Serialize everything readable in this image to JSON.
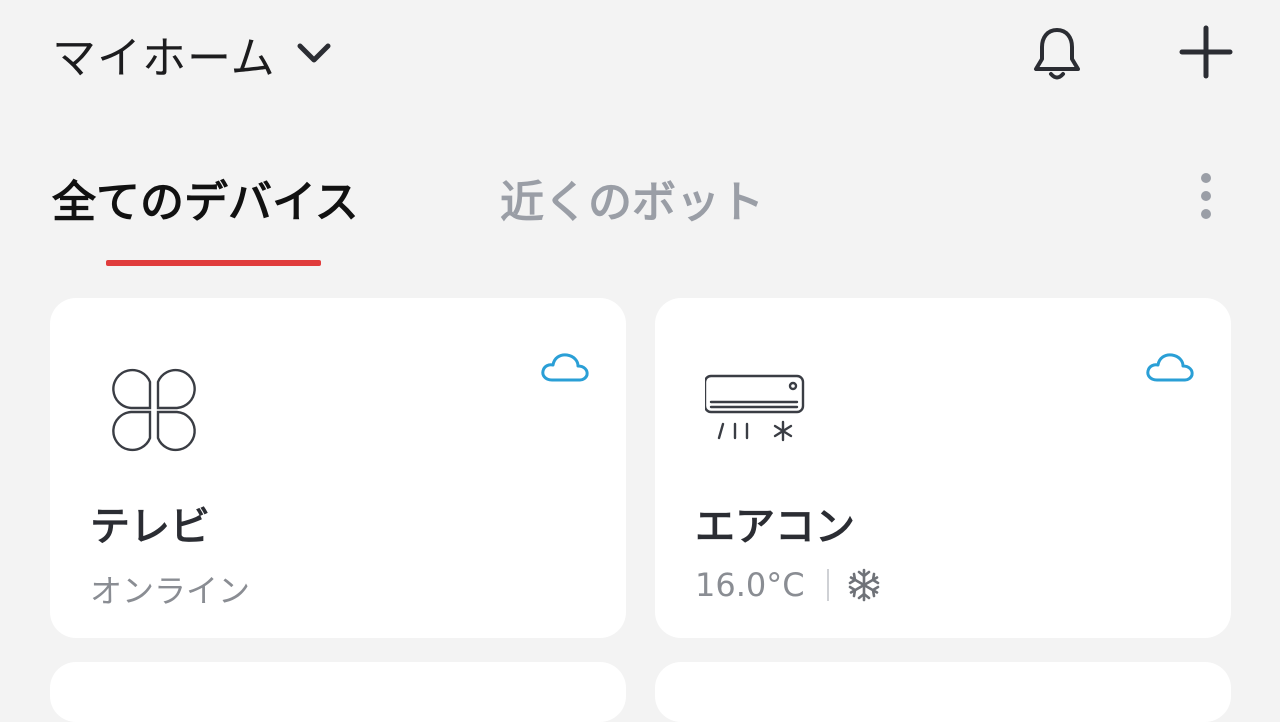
{
  "header": {
    "home_title": "マイホーム",
    "icons": {
      "dropdown": "chevron-down-icon",
      "notifications": "bell-icon",
      "add": "plus-icon"
    }
  },
  "tabs": {
    "items": [
      {
        "label": "全てのデバイス",
        "active": true
      },
      {
        "label": "近くのボット",
        "active": false
      }
    ],
    "more_icon": "more-vertical-icon",
    "accent_color": "#e03c3c"
  },
  "devices": [
    {
      "name": "テレビ",
      "status": "オンライン",
      "icon": "tv-remote-icon",
      "cloud_icon": "cloud-icon"
    },
    {
      "name": "エアコン",
      "temperature": "16.0°C",
      "mode_icon": "snowflake-icon",
      "icon": "air-conditioner-icon",
      "cloud_icon": "cloud-icon"
    }
  ],
  "colors": {
    "background": "#f3f3f3",
    "card": "#ffffff",
    "cloud": "#2a9fd6",
    "inactive_tab": "#9a9ea6"
  }
}
